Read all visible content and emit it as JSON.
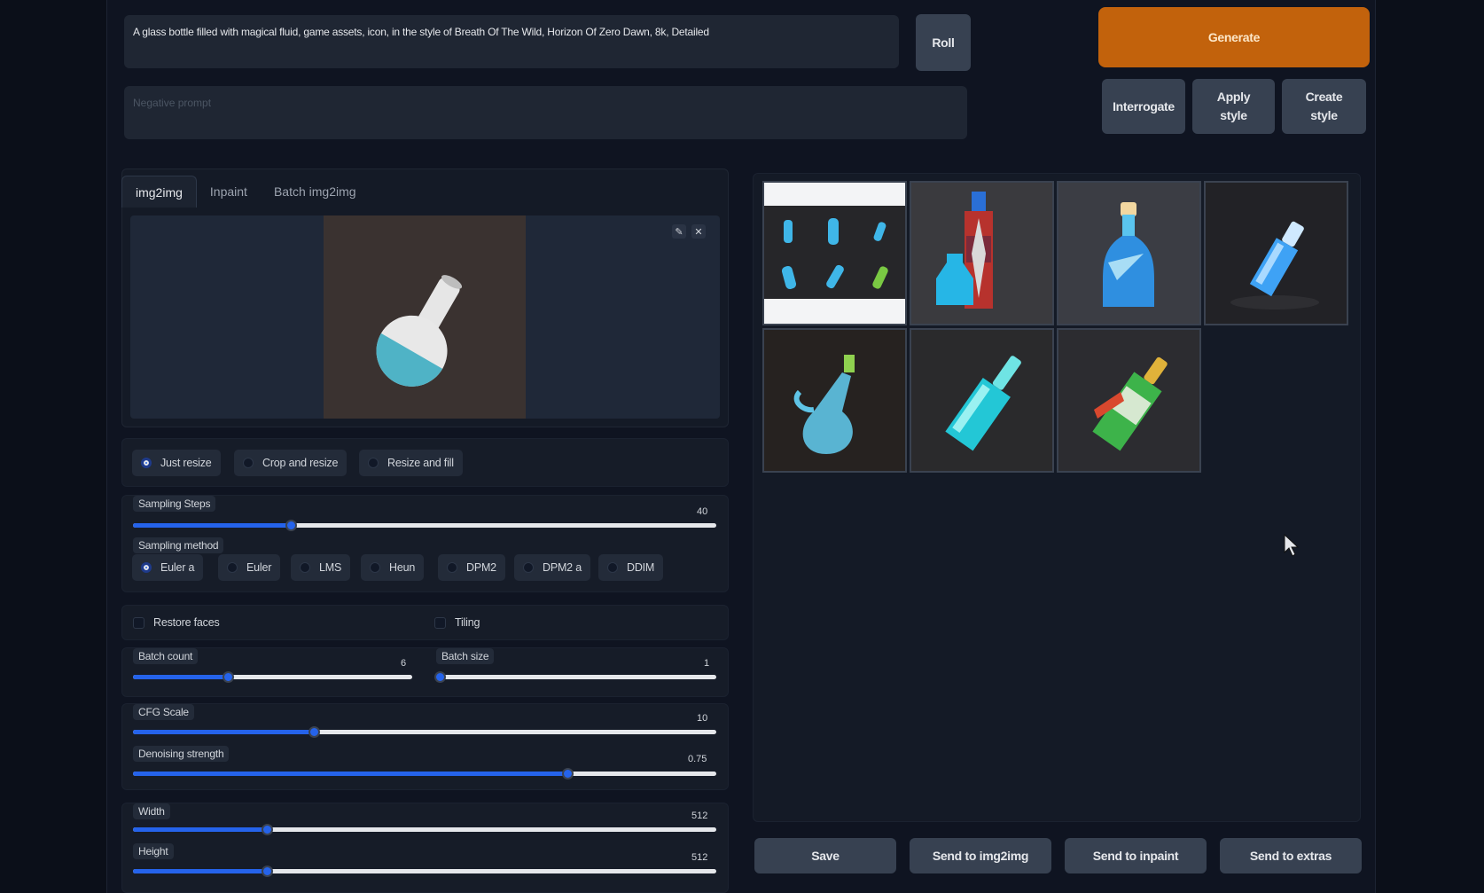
{
  "prompt": {
    "text": "A glass bottle filled with magical fluid, game assets, icon, in the style of Breath Of The Wild, Horizon Of Zero Dawn, 8k, Detailed",
    "negative_placeholder": "Negative prompt"
  },
  "buttons": {
    "roll": "Roll",
    "generate": "Generate",
    "interrogate": "Interrogate",
    "apply_style_1": "Apply",
    "apply_style_2": "style",
    "create_style_1": "Create",
    "create_style_2": "style"
  },
  "tabs": [
    "img2img",
    "Inpaint",
    "Batch img2img"
  ],
  "resize_modes": [
    {
      "label": "Just resize",
      "selected": true
    },
    {
      "label": "Crop and resize",
      "selected": false
    },
    {
      "label": "Resize and fill",
      "selected": false
    }
  ],
  "sampling_steps": {
    "label": "Sampling Steps",
    "value": "40",
    "fraction": 0.27
  },
  "sampling_method": {
    "label": "Sampling method",
    "options": [
      {
        "label": "Euler a",
        "selected": true
      },
      {
        "label": "Euler",
        "selected": false
      },
      {
        "label": "LMS",
        "selected": false
      },
      {
        "label": "Heun",
        "selected": false
      },
      {
        "label": "DPM2",
        "selected": false
      },
      {
        "label": "DPM2 a",
        "selected": false
      },
      {
        "label": "DDIM",
        "selected": false
      }
    ]
  },
  "restore_faces": "Restore faces",
  "tiling": "Tiling",
  "batch_count": {
    "label": "Batch count",
    "value": "6",
    "fraction": 0.34
  },
  "batch_size": {
    "label": "Batch size",
    "value": "1",
    "fraction": 0.0
  },
  "cfg_scale": {
    "label": "CFG Scale",
    "value": "10",
    "fraction": 0.31
  },
  "denoising": {
    "label": "Denoising strength",
    "value": "0.75",
    "fraction": 0.745
  },
  "width": {
    "label": "Width",
    "value": "512",
    "fraction": 0.23
  },
  "height": {
    "label": "Height",
    "value": "512",
    "fraction": 0.23
  },
  "output_actions": [
    "Save",
    "Send to img2img",
    "Send to inpaint",
    "Send to extras"
  ],
  "colors": {
    "accent": "#2563eb",
    "generate": "#c2620c",
    "background": "#0b0f19"
  }
}
